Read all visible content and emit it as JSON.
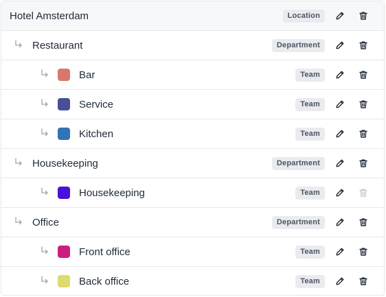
{
  "colors": {
    "row_border": "#e5e7eb",
    "badge_bg": "#e9ebef",
    "badge_text": "#4b5563",
    "icon": "#1f2937",
    "icon_disabled": "#c7cbd2",
    "arrow": "#9ca3af"
  },
  "rows": [
    {
      "level": 0,
      "label": "Hotel Amsterdam",
      "type": "Location",
      "edit_icon": "pencil-icon",
      "delete_icon": "trash-icon",
      "delete_enabled": true
    },
    {
      "level": 1,
      "label": "Restaurant",
      "type": "Department",
      "edit_icon": "pencil-icon",
      "delete_icon": "trash-icon",
      "delete_enabled": true
    },
    {
      "level": 2,
      "label": "Bar",
      "type": "Team",
      "color": "#d9786a",
      "edit_icon": "pencil-icon",
      "delete_icon": "trash-icon",
      "delete_enabled": true
    },
    {
      "level": 2,
      "label": "Service",
      "type": "Team",
      "color": "#4a4e96",
      "edit_icon": "pencil-icon",
      "delete_icon": "trash-icon",
      "delete_enabled": true
    },
    {
      "level": 2,
      "label": "Kitchen",
      "type": "Team",
      "color": "#2f74b7",
      "edit_icon": "pencil-icon",
      "delete_icon": "trash-icon",
      "delete_enabled": true
    },
    {
      "level": 1,
      "label": "Housekeeping",
      "type": "Department",
      "edit_icon": "pencil-icon",
      "delete_icon": "trash-icon",
      "delete_enabled": true
    },
    {
      "level": 2,
      "label": "Housekeeping",
      "type": "Team",
      "color": "#4a12d6",
      "edit_icon": "pencil-icon",
      "delete_icon": "trash-icon",
      "delete_enabled": false
    },
    {
      "level": 1,
      "label": "Office",
      "type": "Department",
      "edit_icon": "pencil-icon",
      "delete_icon": "trash-icon",
      "delete_enabled": true
    },
    {
      "level": 2,
      "label": "Front office",
      "type": "Team",
      "color": "#cc1f7d",
      "edit_icon": "pencil-icon",
      "delete_icon": "trash-icon",
      "delete_enabled": true
    },
    {
      "level": 2,
      "label": "Back office",
      "type": "Team",
      "color": "#dddb6d",
      "edit_icon": "pencil-icon",
      "delete_icon": "trash-icon",
      "delete_enabled": true
    }
  ]
}
